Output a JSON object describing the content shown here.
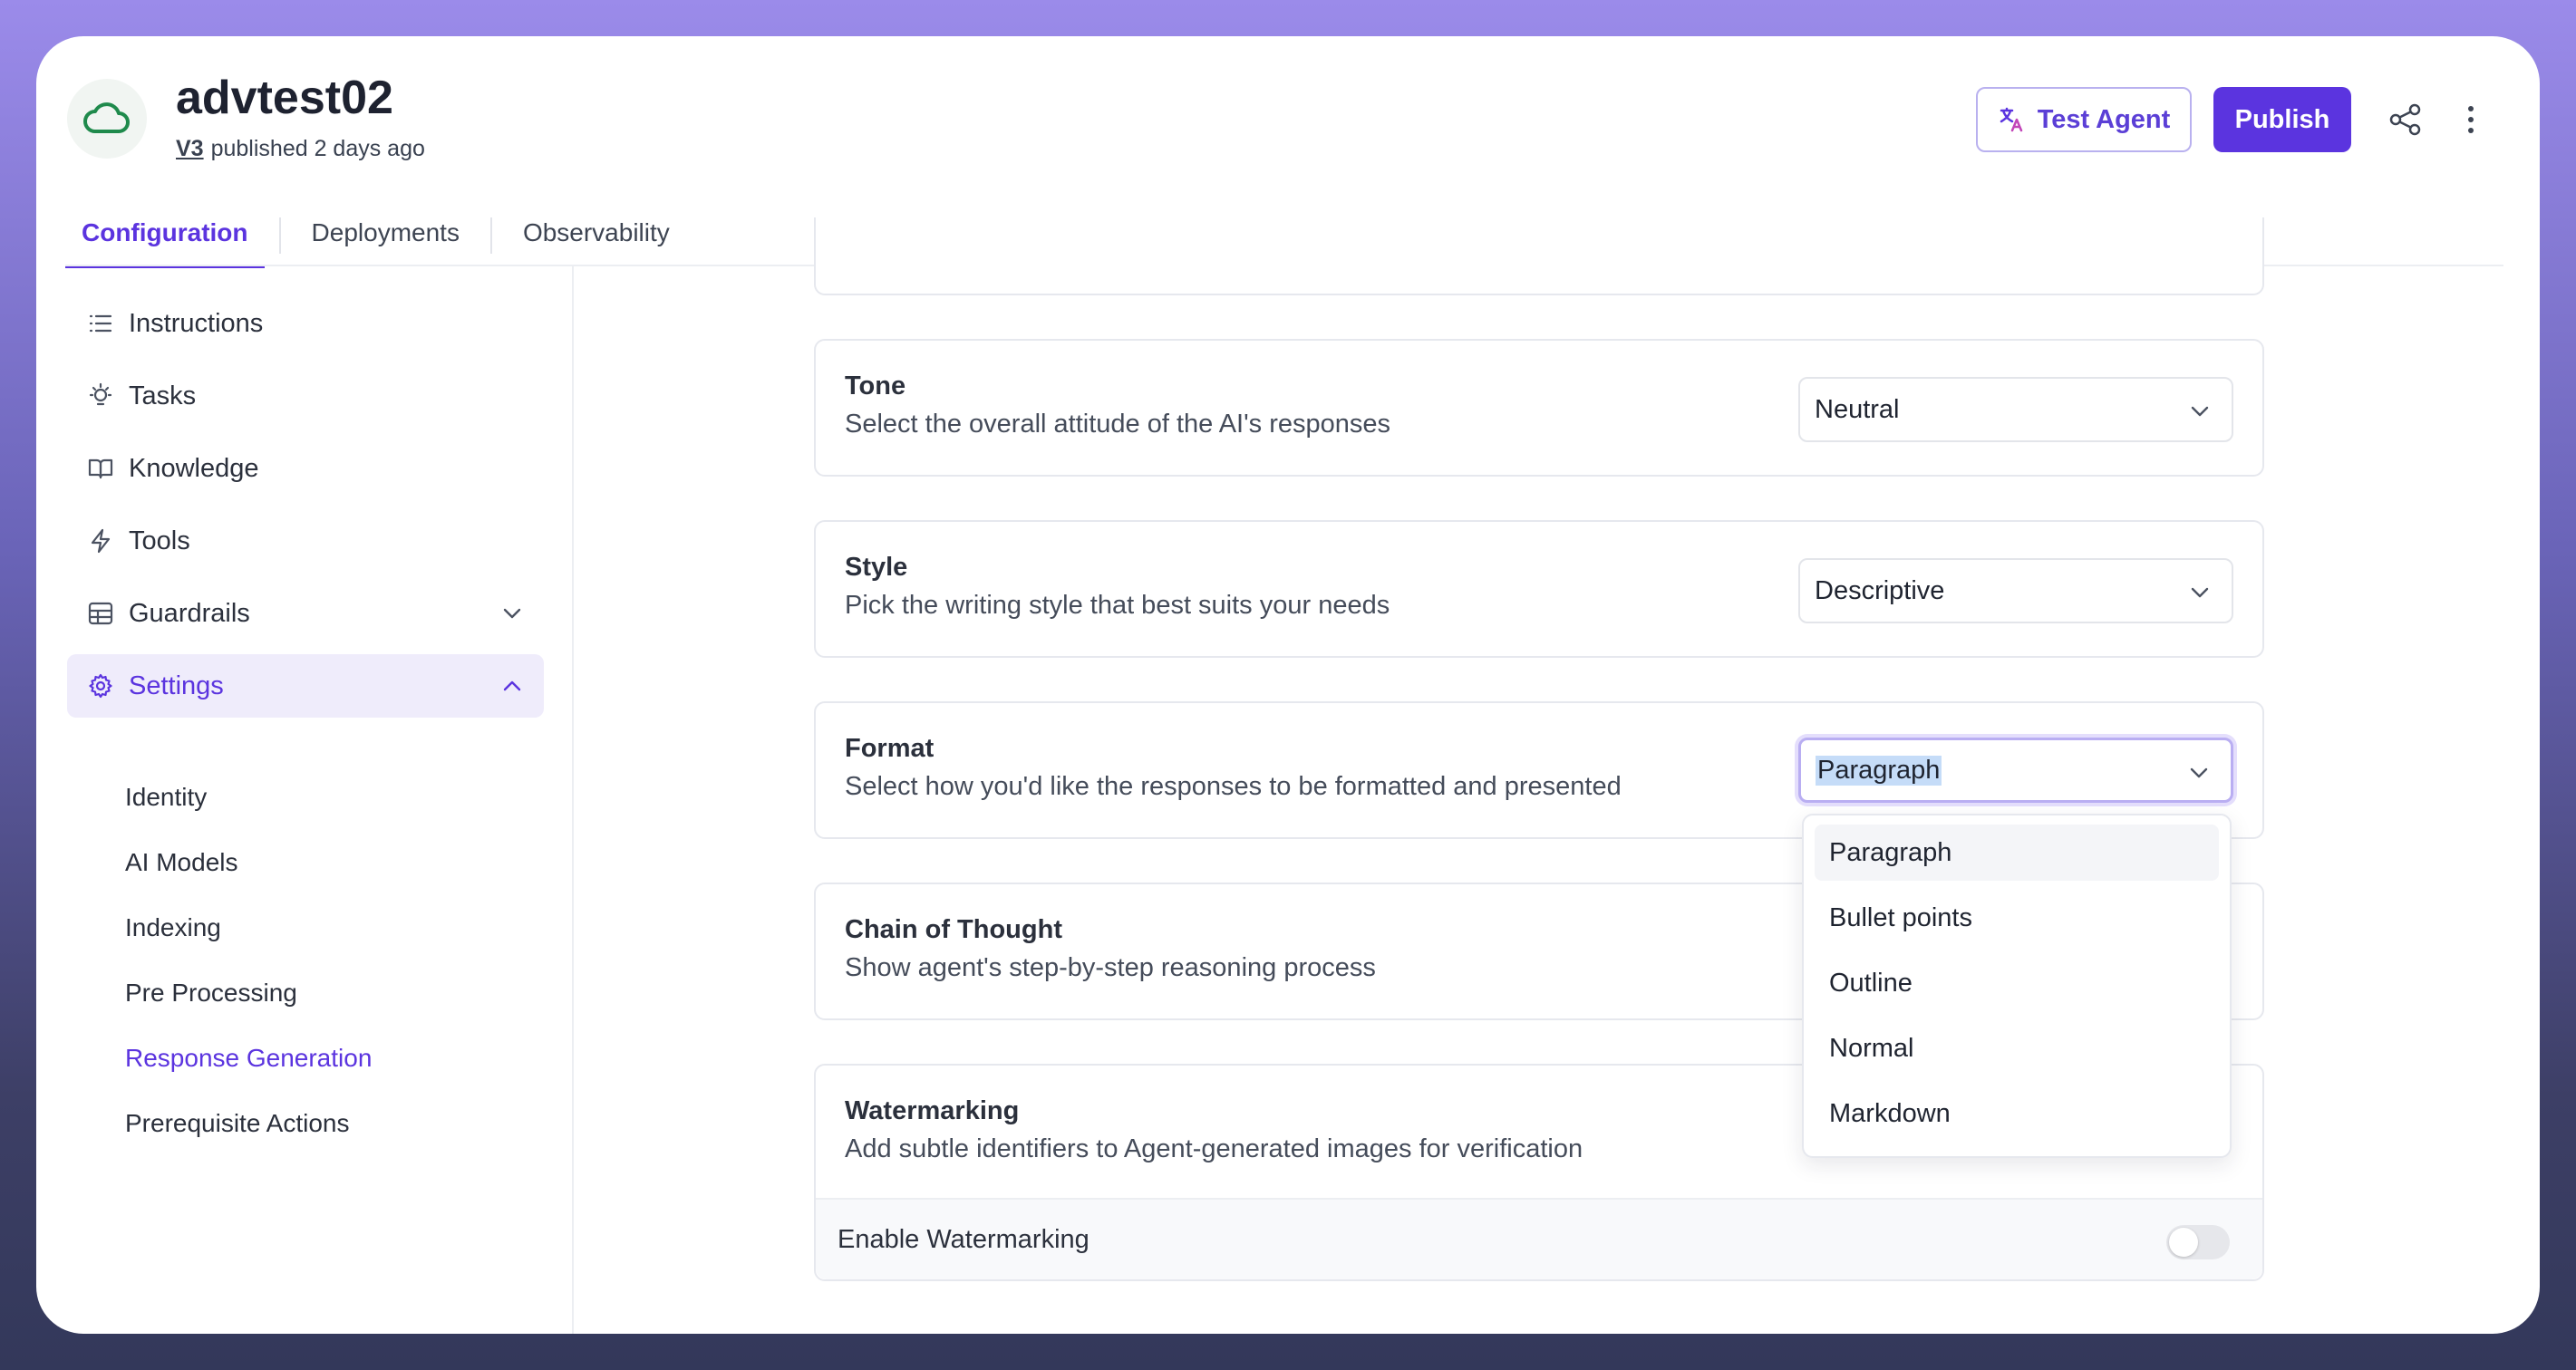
{
  "header": {
    "agent_name": "advtest02",
    "version": "V3",
    "published_text": "published 2 days ago",
    "test_agent_label": "Test Agent",
    "publish_label": "Publish"
  },
  "tabs": [
    {
      "label": "Configuration",
      "active": true
    },
    {
      "label": "Deployments",
      "active": false
    },
    {
      "label": "Observability",
      "active": false
    }
  ],
  "sidebar": {
    "items": [
      {
        "label": "Instructions",
        "icon": "list-icon"
      },
      {
        "label": "Tasks",
        "icon": "lightbulb-icon"
      },
      {
        "label": "Knowledge",
        "icon": "book-icon"
      },
      {
        "label": "Tools",
        "icon": "bolt-icon"
      },
      {
        "label": "Guardrails",
        "icon": "table-icon"
      },
      {
        "label": "Settings",
        "icon": "gear-icon"
      }
    ],
    "settings_children": [
      "Identity",
      "AI Models",
      "Indexing",
      "Pre Processing",
      "Response Generation",
      "Prerequisite Actions"
    ],
    "active_child": "Response Generation"
  },
  "settings": {
    "tone": {
      "title": "Tone",
      "description": "Select the overall attitude of the AI's responses",
      "value": "Neutral"
    },
    "style": {
      "title": "Style",
      "description": "Pick the writing style that best suits your needs",
      "value": "Descriptive"
    },
    "format": {
      "title": "Format",
      "description": "Select how you'd like the responses to be formatted and presented",
      "value": "Paragraph",
      "options": [
        "Paragraph",
        "Bullet points",
        "Outline",
        "Normal",
        "Markdown"
      ]
    },
    "chain_of_thought": {
      "title": "Chain of Thought",
      "description": "Show agent's step-by-step reasoning process"
    },
    "watermarking": {
      "title": "Watermarking",
      "description": "Add subtle identifiers to Agent-generated images for verification",
      "toggle_label": "Enable Watermarking",
      "enabled": false
    }
  },
  "colors": {
    "accent": "#5b34df",
    "active_bg": "#efecfb"
  }
}
